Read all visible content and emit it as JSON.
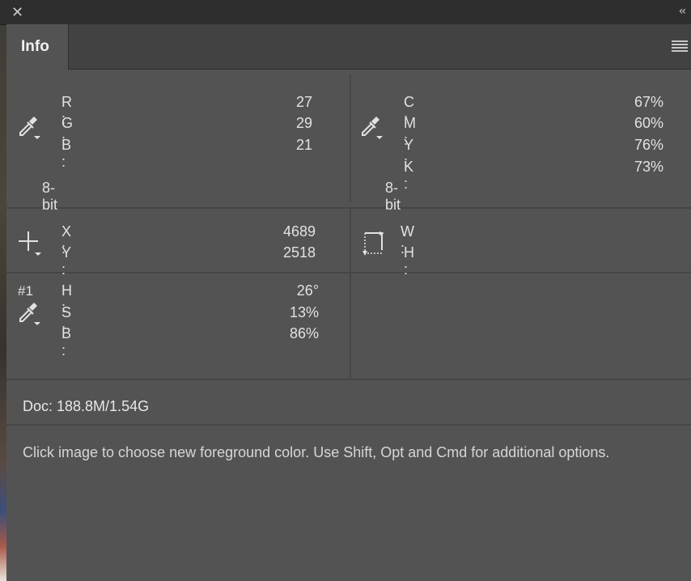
{
  "panel": {
    "tab_label": "Info",
    "close_icon": "close-icon",
    "collapse_label": "‹‹",
    "menu_icon": "panel-menu-icon"
  },
  "rgb": {
    "labels": [
      "R :",
      "G :",
      "B :"
    ],
    "values": [
      "27",
      "29",
      "21"
    ],
    "bit_depth": "8-bit",
    "icon": "eyedropper-icon"
  },
  "cmyk": {
    "labels": [
      "C :",
      "M :",
      "Y :",
      "K :"
    ],
    "values": [
      "67%",
      "60%",
      "76%",
      "73%"
    ],
    "bit_depth": "8-bit",
    "icon": "eyedropper-icon"
  },
  "position": {
    "labels": [
      "X :",
      "Y :"
    ],
    "values": [
      "4689",
      "2518"
    ],
    "icon": "crosshair-icon"
  },
  "size": {
    "labels": [
      "W :",
      "H :"
    ],
    "values": [
      "",
      ""
    ],
    "icon": "selection-size-icon"
  },
  "sampler": {
    "number": "#1",
    "labels": [
      "H :",
      "S :",
      "B :"
    ],
    "values": [
      "26°",
      "13%",
      "86%"
    ],
    "icon": "eyedropper-icon"
  },
  "doc": "Doc: 188.8M/1.54G",
  "help_text": "Click image to choose new foreground color.  Use Shift, Opt and Cmd for additional options."
}
